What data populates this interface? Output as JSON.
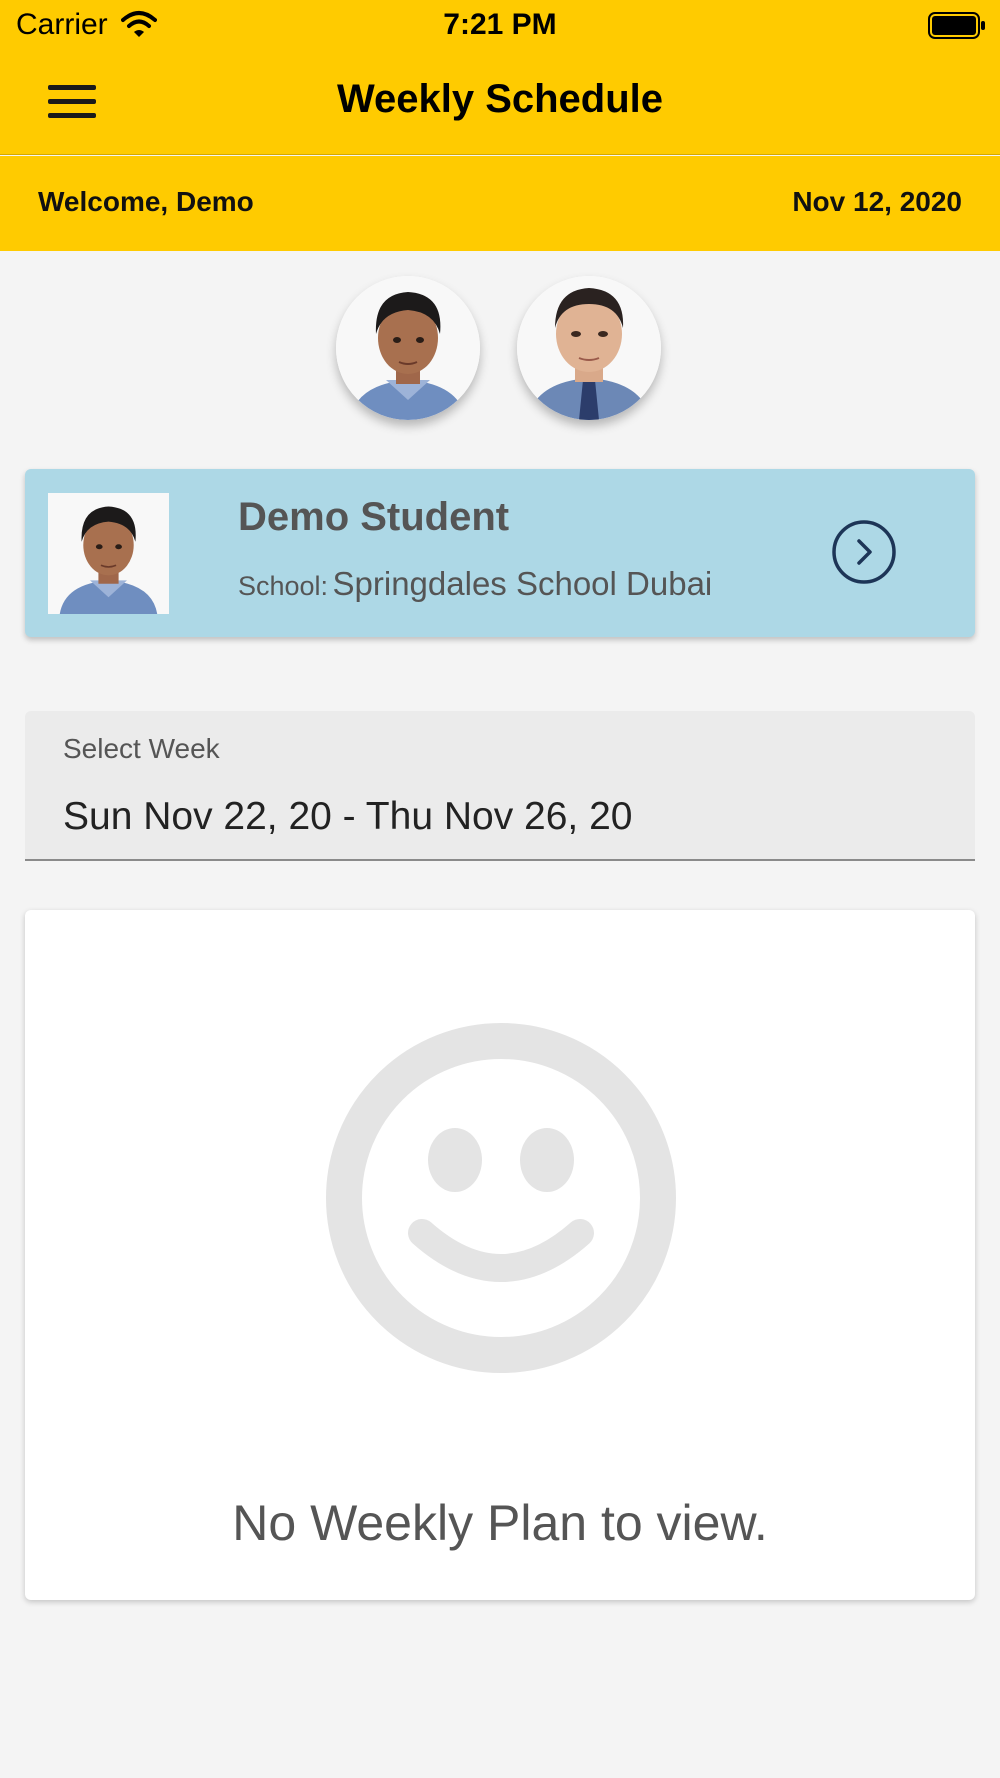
{
  "status_bar": {
    "carrier": "Carrier",
    "time": "7:21 PM",
    "wifi_icon": "wifi-icon",
    "battery_icon": "battery-icon"
  },
  "nav": {
    "title": "Weekly Schedule",
    "menu_icon": "hamburger-menu-icon"
  },
  "welcome": {
    "greeting": "Welcome, Demo",
    "date": "Nov 12, 2020"
  },
  "avatars": [
    {
      "name": "student-avatar-1"
    },
    {
      "name": "student-avatar-2"
    }
  ],
  "student_card": {
    "name": "Demo Student",
    "school_label": "School:",
    "school_name": "Springdales School Dubai",
    "action_icon": "chevron-right-circle-icon"
  },
  "week_select": {
    "label": "Select Week",
    "value": "Sun Nov 22, 20 - Thu Nov 26, 20"
  },
  "empty_state": {
    "icon": "smiley-face-icon",
    "message": "No Weekly Plan to view."
  },
  "colors": {
    "header": "#ffcb00",
    "card_blue": "#add8e6",
    "background": "#f4f4f4",
    "empty_icon": "#e4e4e4"
  }
}
